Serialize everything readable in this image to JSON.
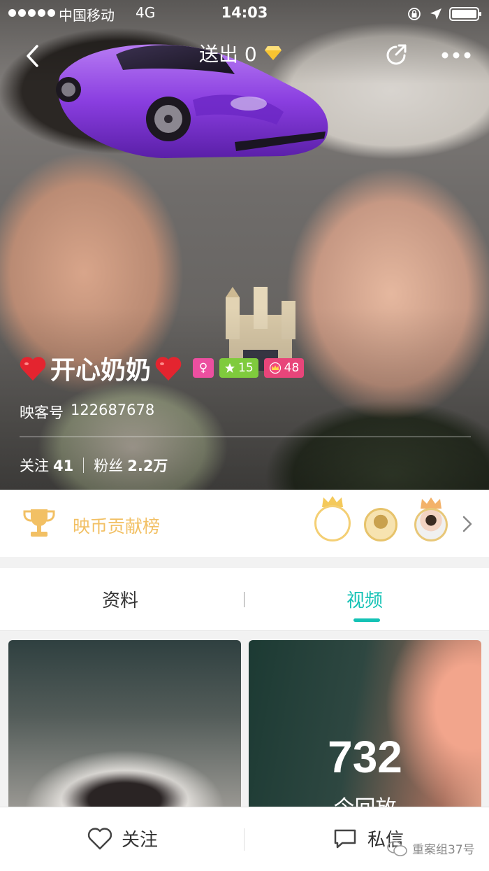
{
  "status_bar": {
    "carrier": "中国移动",
    "network": "4G",
    "time": "14:03"
  },
  "nav": {
    "gift_sent": "送出 0"
  },
  "profile": {
    "name": "开心奶奶",
    "gender_symbol": "♀",
    "star_level": "15",
    "crown_level": "48",
    "id_label": "映客号",
    "id_value": "122687678",
    "following_label": "关注",
    "following_count": "41",
    "followers_label": "粉丝",
    "followers_count": "2.2万"
  },
  "ranking": {
    "label": "映币贡献榜"
  },
  "tabs": {
    "info": "资料",
    "videos": "视频"
  },
  "videos": [
    {
      "play_count": ""
    },
    {
      "play_count": "732",
      "play_label": "今回放"
    }
  ],
  "actions": {
    "follow": "关注",
    "message": "私信"
  },
  "watermark": "重案组37号",
  "colors": {
    "accent": "#14c2b5",
    "gold": "#f2c064",
    "badge_pink": "#ec4fa0",
    "badge_green": "#7fcb3d",
    "badge_red": "#e8457a"
  }
}
